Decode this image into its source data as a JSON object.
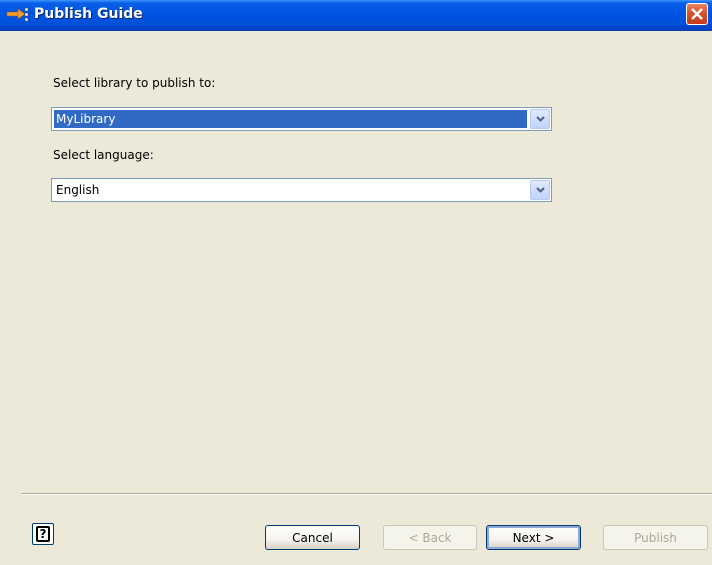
{
  "window": {
    "title": "Publish Guide",
    "icon": "publish-arrow-icon",
    "close_icon": "close-icon"
  },
  "form": {
    "library_label": "Select library to publish to:",
    "library_value": "MyLibrary",
    "language_label": "Select language:",
    "language_value": "English"
  },
  "footer": {
    "help_icon": "help-icon",
    "cancel_label": "Cancel",
    "back_label": "< Back",
    "next_label": "Next >",
    "publish_label": "Publish"
  },
  "colors": {
    "titlebar": "#0054e3",
    "selection": "#316ac5",
    "dialog_background": "#ece9d8",
    "close_button": "#d8532a"
  }
}
